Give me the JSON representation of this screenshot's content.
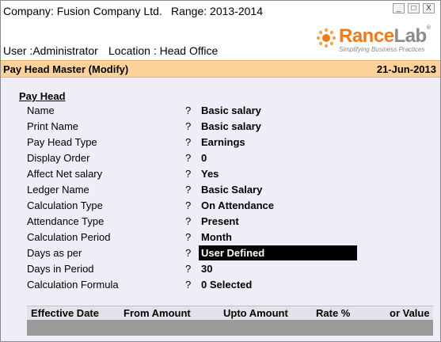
{
  "header": {
    "company": "Company: Fusion Company Ltd.",
    "range": "Range: 2013-2014",
    "user": "User :Administrator",
    "location": "Location : Head Office",
    "window_controls": {
      "minimize": "_",
      "restore": "□",
      "close": "X"
    },
    "logo": {
      "brand_a": "Rance",
      "brand_b": "Lab",
      "reg": "®",
      "tagline": "Simplifying Business Practices"
    }
  },
  "titlebar": {
    "title": "Pay Head Master (Modify)",
    "date": "21-Jun-2013"
  },
  "form": {
    "section_title": "Pay Head",
    "fields": [
      {
        "label": "Name",
        "value": "Basic salary"
      },
      {
        "label": "Print Name",
        "value": "Basic salary"
      },
      {
        "label": "Pay Head Type",
        "value": "Earnings"
      },
      {
        "label": "Display Order",
        "value": "0"
      },
      {
        "label": "Affect Net salary",
        "value": "Yes"
      },
      {
        "label": "Ledger Name",
        "value": "Basic Salary"
      },
      {
        "label": "Calculation Type",
        "value": "On Attendance"
      },
      {
        "label": "Attendance Type",
        "value": "Present"
      },
      {
        "label": "Calculation Period",
        "value": "Month"
      },
      {
        "label": "Days as per",
        "value": "User Defined"
      },
      {
        "label": "Days in Period",
        "value": "30"
      },
      {
        "label": "Calculation Formula",
        "value": "0 Selected"
      }
    ],
    "separator": "?"
  },
  "grid": {
    "columns": [
      "Effective Date",
      "From Amount",
      "Upto Amount",
      "Rate %",
      "or Value"
    ]
  },
  "colors": {
    "titlebar_bg": "#fcd29a",
    "main_bg": "#eeeef8",
    "logo_orange": "#f07a1a",
    "selected_bg": "#000000"
  }
}
